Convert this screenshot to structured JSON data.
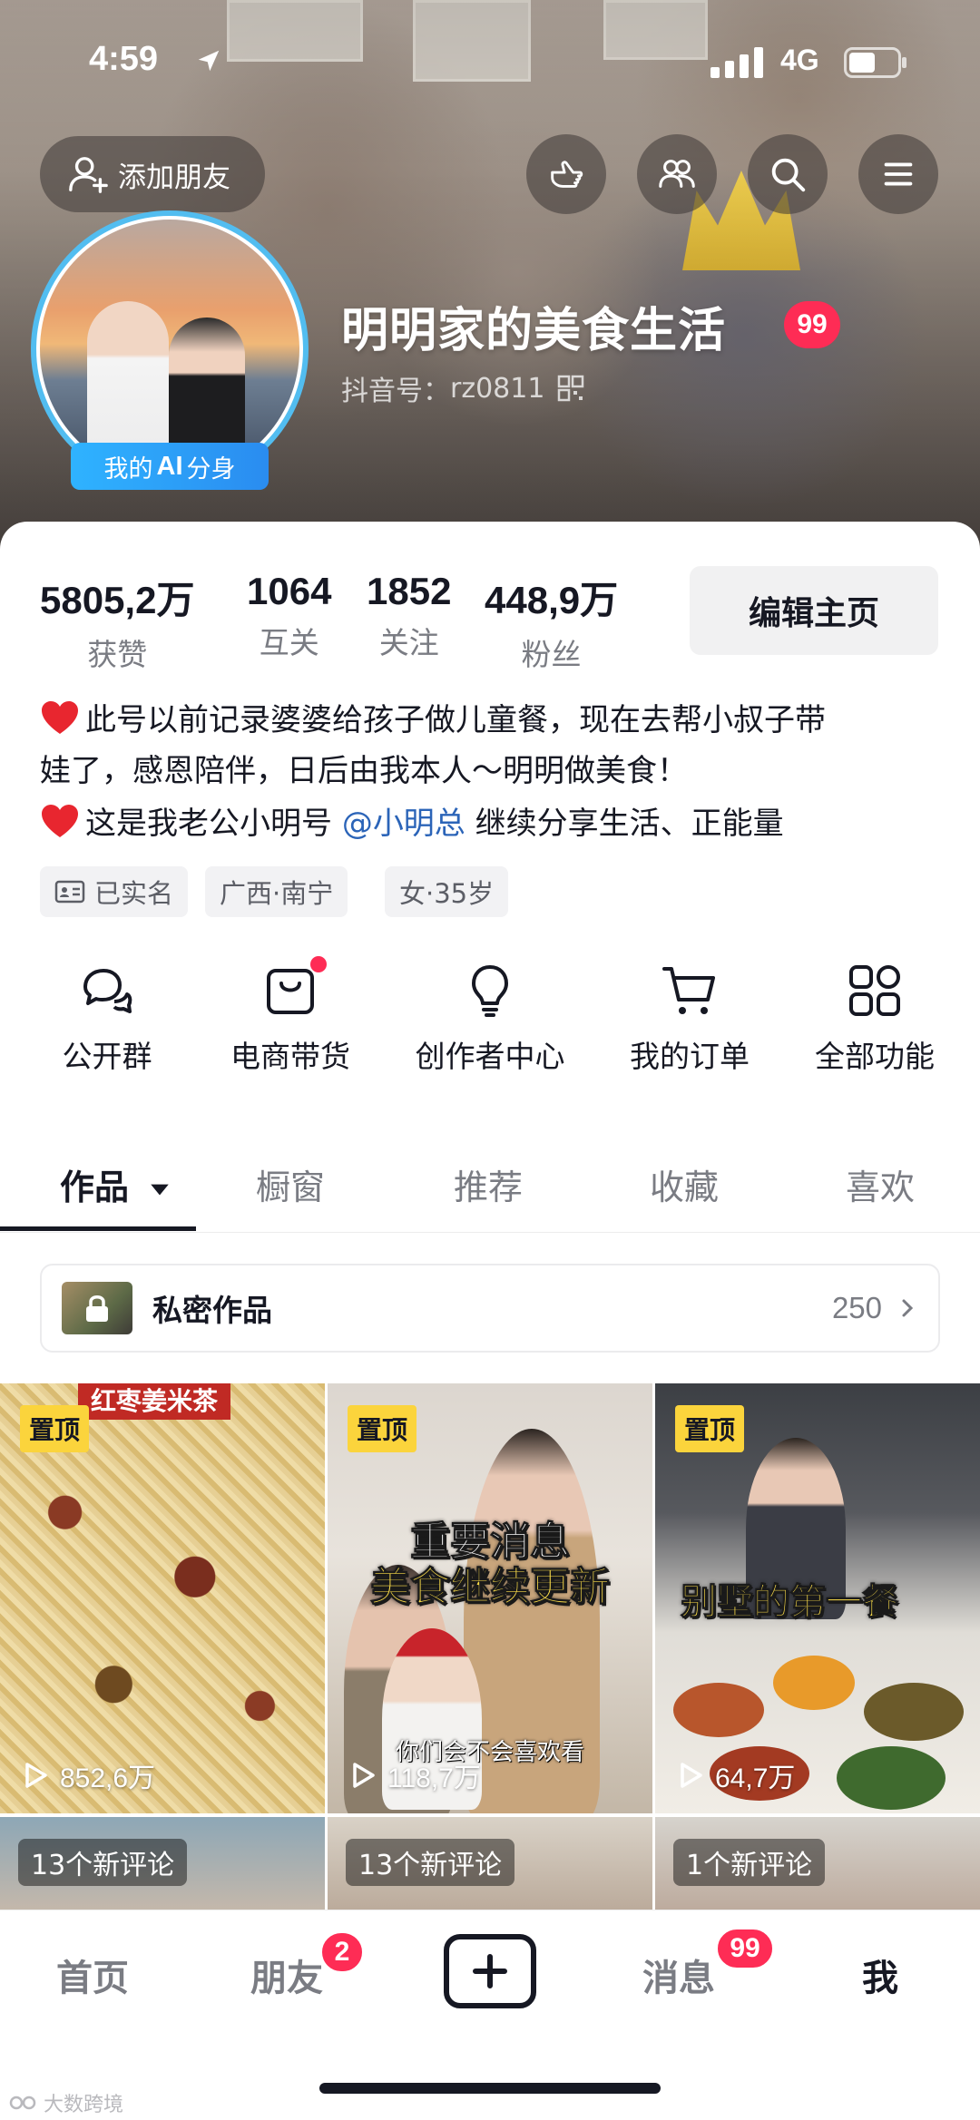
{
  "status_bar": {
    "time": "4:59",
    "network": "4G"
  },
  "header": {
    "add_friend_label": "添加朋友",
    "profile_name": "明明家的美食生活",
    "name_badge": "99",
    "douyin_id_label": "抖音号：",
    "douyin_id": "rz0811",
    "ai_badge_prefix": "我的",
    "ai_badge_ai": "AI",
    "ai_badge_suffix": "分身"
  },
  "stats": [
    {
      "value": "5805,2万",
      "label": "获赞"
    },
    {
      "value": "1064",
      "label": "互关"
    },
    {
      "value": "1852",
      "label": "关注"
    },
    {
      "value": "448,9万",
      "label": "粉丝"
    }
  ],
  "edit_profile_label": "编辑主页",
  "bio": {
    "line1": "此号以前记录婆婆给孩子做儿童餐，现在去帮小叔子带",
    "line2": "娃了，感恩陪伴，日后由我本人～明明做美食！",
    "line3_prefix": "这是我老公小明号",
    "line3_mention": "@小明总",
    "line3_suffix": " 继续分享生活、正能量"
  },
  "tags": [
    "已实名",
    "广西·南宁",
    "女·35岁"
  ],
  "shortcuts": [
    "公开群",
    "电商带货",
    "创作者中心",
    "我的订单",
    "全部功能"
  ],
  "tabs": [
    "作品",
    "橱窗",
    "推荐",
    "收藏",
    "喜欢"
  ],
  "private_works": {
    "label": "私密作品",
    "count": "250"
  },
  "videos": [
    {
      "pinned_label": "置顶",
      "top_caption": "红枣姜米茶",
      "views": "852,6万"
    },
    {
      "pinned_label": "置顶",
      "caption_line1": "重要消息",
      "caption_line2": "美食继续更新",
      "sub_caption": "你们会不会喜欢看",
      "views": "118,7万"
    },
    {
      "pinned_label": "置顶",
      "caption_line1": "别墅的第一餐",
      "views": "64,7万"
    }
  ],
  "videos_row2": [
    {
      "new_comments": "13个新评论"
    },
    {
      "new_comments": "13个新评论"
    },
    {
      "new_comments": "1个新评论"
    }
  ],
  "bottom_nav": {
    "home": "首页",
    "friends": "朋友",
    "friends_badge": "2",
    "messages": "消息",
    "messages_badge": "99",
    "me": "我"
  },
  "watermark": "大数跨境",
  "colors": {
    "accent_red": "#fe2c55",
    "mention_blue": "#2b64b8",
    "pin_yellow": "#fbd43c",
    "ai_blue": "#2a8cf0"
  }
}
